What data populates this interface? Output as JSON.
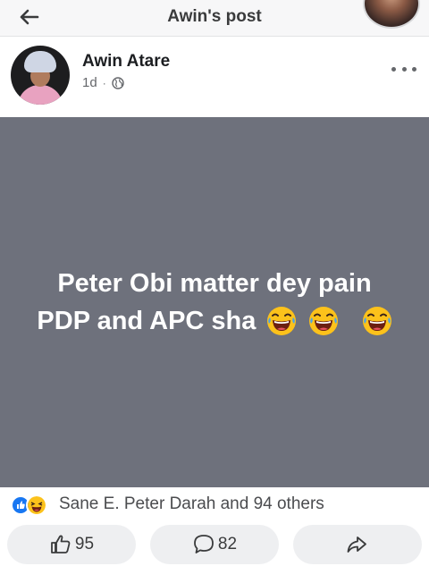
{
  "topbar": {
    "title": "Awin's post",
    "back_icon": "arrow-left-icon"
  },
  "post": {
    "author": "Awin Atare",
    "time": "1d",
    "separator": "·",
    "privacy_icon": "globe-icon",
    "text_line1": "Peter Obi matter dey pain",
    "text_line2": "PDP and APC sha",
    "emoji": "face-with-tears-of-joy",
    "background_color": "#6e717c"
  },
  "reactions": {
    "icons": [
      "like-icon",
      "haha-icon"
    ],
    "summary": "Sane E. Peter Darah and 94 others"
  },
  "actions": {
    "like_count": "95",
    "comment_count": "82",
    "share_icon": "share-icon"
  }
}
